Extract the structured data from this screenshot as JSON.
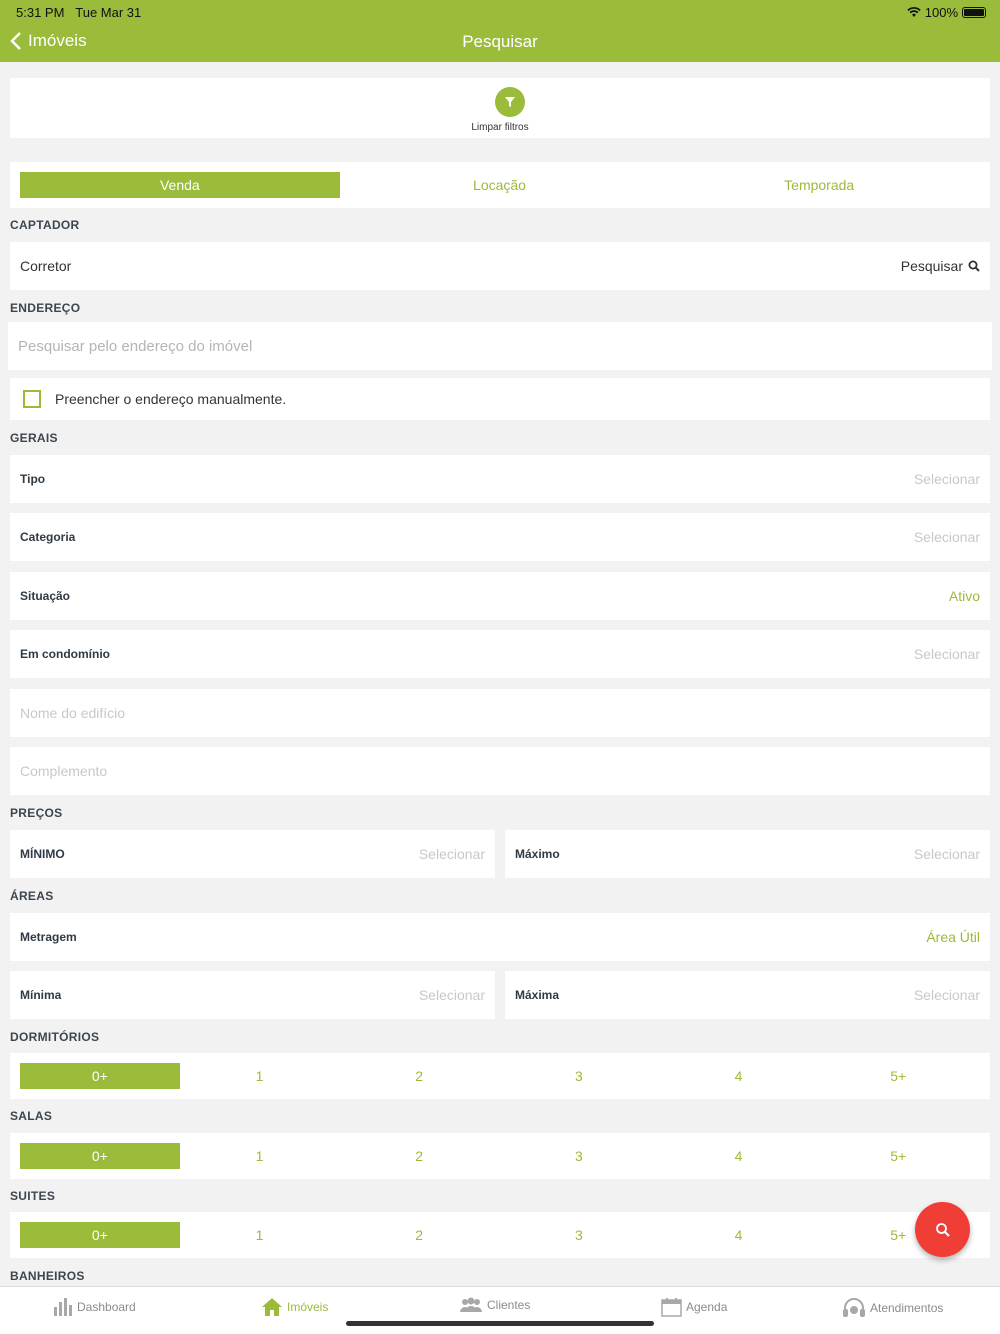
{
  "status_bar": {
    "time": "5:31 PM",
    "date": "Tue Mar 31",
    "battery": "100%"
  },
  "nav": {
    "back_label": "Imóveis",
    "title": "Pesquisar"
  },
  "filters": {
    "clear_label": "Limpar filtros"
  },
  "transaction_tabs": [
    {
      "label": "Venda",
      "active": true
    },
    {
      "label": "Locação",
      "active": false
    },
    {
      "label": "Temporada",
      "active": false
    }
  ],
  "captador": {
    "section": "CAPTADOR",
    "label": "Corretor",
    "action": "Pesquisar"
  },
  "endereco": {
    "section": "ENDEREÇO",
    "placeholder": "Pesquisar pelo endereço do imóvel",
    "manual_label": "Preencher o endereço manualmente."
  },
  "gerais": {
    "section": "GERAIS",
    "tipo": {
      "label": "Tipo",
      "value": "Selecionar"
    },
    "categoria": {
      "label": "Categoria",
      "value": "Selecionar"
    },
    "situacao": {
      "label": "Situação",
      "value": "Ativo"
    },
    "condominio": {
      "label": "Em condomínio",
      "value": "Selecionar"
    },
    "edificio_placeholder": "Nome do edifício",
    "complemento_placeholder": "Complemento"
  },
  "precos": {
    "section": "PREÇOS",
    "minimo": {
      "label": "MÍNIMO",
      "value": "Selecionar"
    },
    "maximo": {
      "label": "Máximo",
      "value": "Selecionar"
    }
  },
  "areas": {
    "section": "ÁREAS",
    "metragem": {
      "label": "Metragem",
      "value": "Área Útil"
    },
    "minima": {
      "label": "Mínima",
      "value": "Selecionar"
    },
    "maxima": {
      "label": "Máxima",
      "value": "Selecionar"
    }
  },
  "dormitorios": {
    "section": "DORMITÓRIOS",
    "options": [
      "0+",
      "1",
      "2",
      "3",
      "4",
      "5+"
    ]
  },
  "salas": {
    "section": "SALAS",
    "options": [
      "0+",
      "1",
      "2",
      "3",
      "4",
      "5+"
    ]
  },
  "suites": {
    "section": "SUITES",
    "options": [
      "0+",
      "1",
      "2",
      "3",
      "4",
      "5+"
    ]
  },
  "banheiros": {
    "section": "BANHEIROS"
  },
  "tabbar": [
    {
      "label": "Dashboard",
      "icon": "bar-chart-icon"
    },
    {
      "label": "Imóveis",
      "icon": "home-icon",
      "active": true
    },
    {
      "label": "Clientes",
      "icon": "users-icon"
    },
    {
      "label": "Agenda",
      "icon": "calendar-icon"
    },
    {
      "label": "Atendimentos",
      "icon": "headset-icon"
    }
  ],
  "colors": {
    "accent": "#9bbb3b",
    "fab": "#f03e36"
  }
}
